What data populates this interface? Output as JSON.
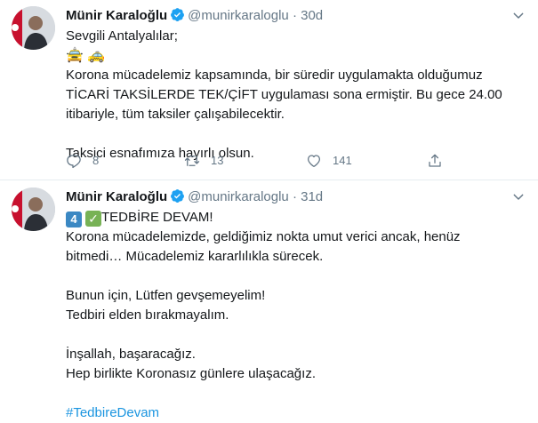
{
  "tweets": [
    {
      "name": "Münir Karaloğlu",
      "handle": "@munirkaraloglu",
      "dot": "·",
      "time": "30d",
      "lines": {
        "l1": "Sevgili Antalyalılar;",
        "l2": "🚖 🚕",
        "l3": "Korona mücadelemiz kapsamında, bir süredir uygulamakta olduğumuz",
        "l4": "TİCARİ TAKSİLERDE TEK/ÇİFT uygulaması sona ermiştir. Bu gece 24.00",
        "l5": "itibariyle, tüm taksiler çalışabilecektir.",
        "l6": "Taksici esnafımıza hayırlı olsun."
      },
      "actions": {
        "replies": "8",
        "retweets": "13",
        "likes": "141"
      }
    },
    {
      "name": "Münir Karaloğlu",
      "handle": "@munirkaraloglu",
      "dot": "·",
      "time": "31d",
      "lines": {
        "l1_num": "4",
        "l1_check": "✓",
        "l1_text": "TEDBİRE DEVAM!",
        "l2": "Korona mücadelemizde, geldiğimiz nokta umut verici ancak, henüz",
        "l3": "bitmedi… Mücadelemiz kararlılıkla sürecek.",
        "l4": "Bunun için, Lütfen gevşemeyelim!",
        "l5": "Tedbiri elden bırakmayalım.",
        "l6": "İnşallah, başaracağız.",
        "l7": "Hep birlikte Koronasız günlere ulaşacağız.",
        "hashtag": "#TedbireDevam"
      }
    }
  ],
  "colors": {
    "link": "#1b95e0",
    "muted": "#657786",
    "verified": "#1da1f2"
  }
}
